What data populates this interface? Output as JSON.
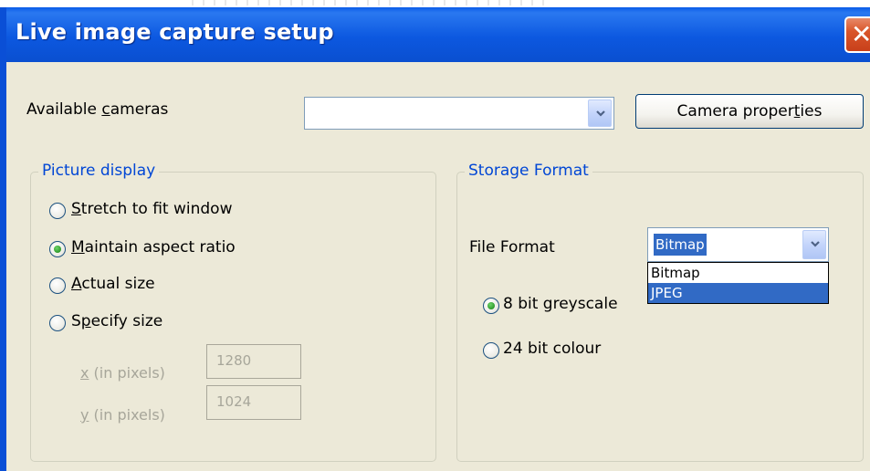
{
  "window": {
    "title": "Live image capture setup",
    "close_symbol": "✕"
  },
  "cameras": {
    "label_prefix": "Available ",
    "label_access": "c",
    "label_suffix": "ameras",
    "selected_value": "",
    "properties_button_prefix": "Camera proper",
    "properties_button_access": "t",
    "properties_button_suffix": "ies"
  },
  "picture_display": {
    "title": "Picture display",
    "options": [
      {
        "access": "S",
        "rest": "tretch to fit window",
        "selected": false
      },
      {
        "access": "M",
        "rest": "aintain aspect ratio",
        "selected": true
      },
      {
        "access": "A",
        "rest": "ctual size",
        "selected": false
      },
      {
        "first": "S",
        "access": "p",
        "rest": "ecify size",
        "selected": false
      }
    ],
    "x_label_access": "x",
    "x_label_rest": " (in pixels)",
    "x_value": "1280",
    "y_label_access": "y",
    "y_label_rest": " (in pixels)",
    "y_value": "1024"
  },
  "storage_format": {
    "title": "Storage Format",
    "file_format_label": "File Format",
    "file_format_selected": "Bitmap",
    "file_format_options": [
      "Bitmap",
      "JPEG"
    ],
    "highlighted_option": "JPEG",
    "bit_options": [
      {
        "label": "8 bit greyscale",
        "selected": true
      },
      {
        "label": "24 bit colour",
        "selected": false
      }
    ]
  },
  "colors": {
    "title_bar": "#0a5ce8",
    "group_title": "#0046d5",
    "selection": "#316ac5",
    "dialog_face": "#ece9d8"
  }
}
